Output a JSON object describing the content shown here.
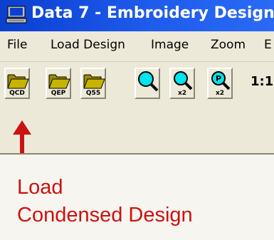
{
  "window": {
    "title": "Data 7 - Embroidery Design"
  },
  "menu": {
    "items": [
      "File",
      "Load Design",
      "Image",
      "Zoom",
      "E"
    ]
  },
  "toolbar": {
    "buttons": [
      {
        "icon": "folder-icon",
        "caption": "QCD"
      },
      {
        "icon": "folder-icon",
        "caption": "QEP"
      },
      {
        "icon": "folder-icon",
        "caption": "Q55"
      },
      {
        "icon": "magnifier-icon",
        "caption": ""
      },
      {
        "icon": "magnifier-zoom-x2-icon",
        "caption": "x2"
      },
      {
        "icon": "magnifier-p-x2-icon",
        "caption": "x2"
      }
    ],
    "zoom_label": "1:1"
  },
  "annotation": {
    "line1": "Load",
    "line2": "Condensed Design",
    "color": "#cc1111"
  },
  "colors": {
    "titlebar": "#0a3fd0",
    "chrome": "#ece9d8",
    "folder": "#c7b400",
    "magnifier": "#00e5ee"
  }
}
